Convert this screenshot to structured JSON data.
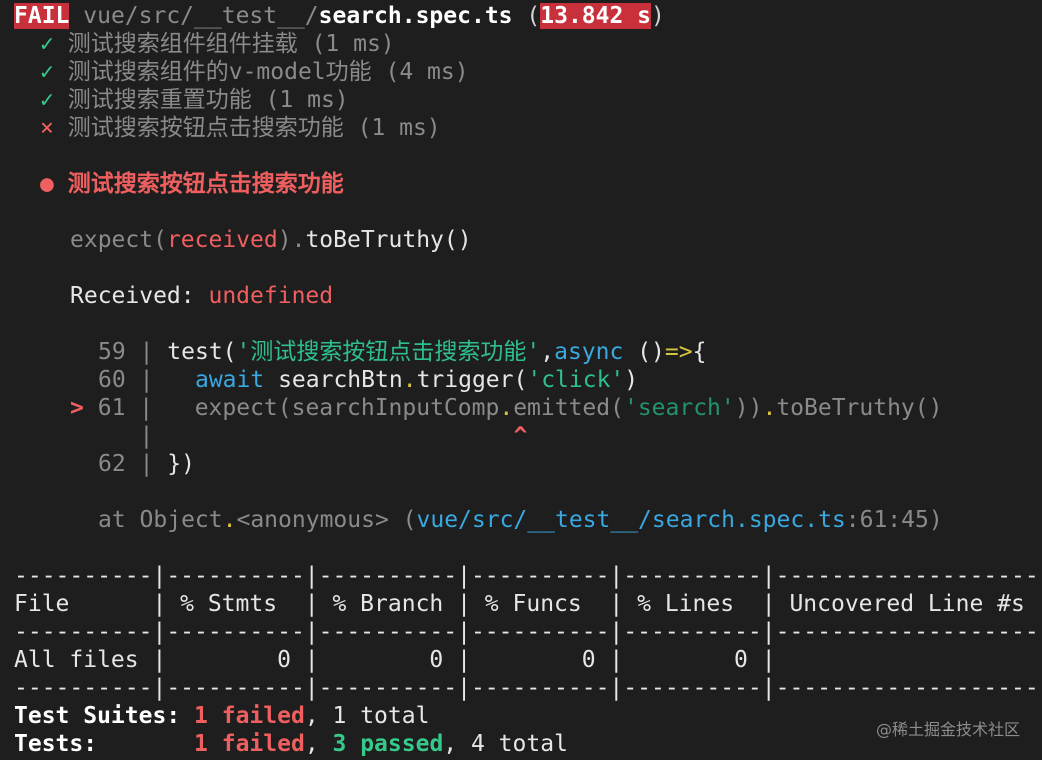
{
  "header": {
    "status": "FAIL",
    "path_dim": "vue/src/__test__/",
    "file": "search.spec.ts",
    "open_paren": "(",
    "time": "13.842 s",
    "close_paren": ")"
  },
  "tests": [
    {
      "mark": "✓",
      "text": "测试搜索组件组件挂载 (1 ms)",
      "status": "passed"
    },
    {
      "mark": "✓",
      "text": "测试搜索组件的v-model功能 (4 ms)",
      "status": "passed"
    },
    {
      "mark": "✓",
      "text": "测试搜索重置功能 (1 ms)",
      "status": "passed"
    },
    {
      "mark": "×",
      "text": "测试搜索按钮点击搜索功能 (1 ms)",
      "status": "failed"
    }
  ],
  "failure": {
    "bullet": "●",
    "title": "测试搜索按钮点击搜索功能",
    "expect_prefix": "expect(",
    "expect_received": "received",
    "expect_close": ")",
    "expect_dot": ".",
    "expect_matcher": "toBeTruthy()",
    "received_label": "Received: ",
    "received_value": "undefined"
  },
  "code": {
    "l59_num": "59",
    "l59_pre": "test(",
    "l59_str": "'测试搜索按钮点击搜索功能'",
    "l59_comma": ",",
    "l59_async": "async",
    "l59_mid": " ()",
    "l59_arrow": "=>",
    "l59_brace": "{",
    "l60_num": "60",
    "l60_await": "await",
    "l60_mid": " searchBtn",
    "l60_dot": ".",
    "l60_call": "trigger(",
    "l60_str": "'click'",
    "l60_close": ")",
    "l61_marker": ">",
    "l61_num": "61",
    "l61_pre": "expect(searchInputComp",
    "l61_dot1": ".",
    "l61_call": "emitted(",
    "l61_str": "'search'",
    "l61_close": "))",
    "l61_dot2": ".",
    "l61_matcher": "toBeTruthy()",
    "caret": "^",
    "l62_num": "62",
    "l62_text": "})",
    "sep": "|"
  },
  "stack": {
    "prefix": "at Object",
    "dot": ".",
    "anon": "<anonymous> (",
    "link": "vue/src/__test__/search.spec.ts",
    "loc": ":61:45)"
  },
  "coverage": {
    "rule": "----------|----------|----------|----------|----------|-------------------",
    "header": "File      | % Stmts  | % Branch | % Funcs  | % Lines  | Uncovered Line #s ",
    "row": "All files |        0 |        0 |        0 |        0 |                   "
  },
  "summary": {
    "suites_label": "Test Suites:",
    "suites_failed": "1 failed",
    "suites_total": ", 1 total",
    "tests_label": "Tests:",
    "tests_failed": "1 failed",
    "tests_sep": ", ",
    "tests_passed": "3 passed",
    "tests_total": ", 4 total"
  },
  "watermark": "@稀土掘金技术社区"
}
